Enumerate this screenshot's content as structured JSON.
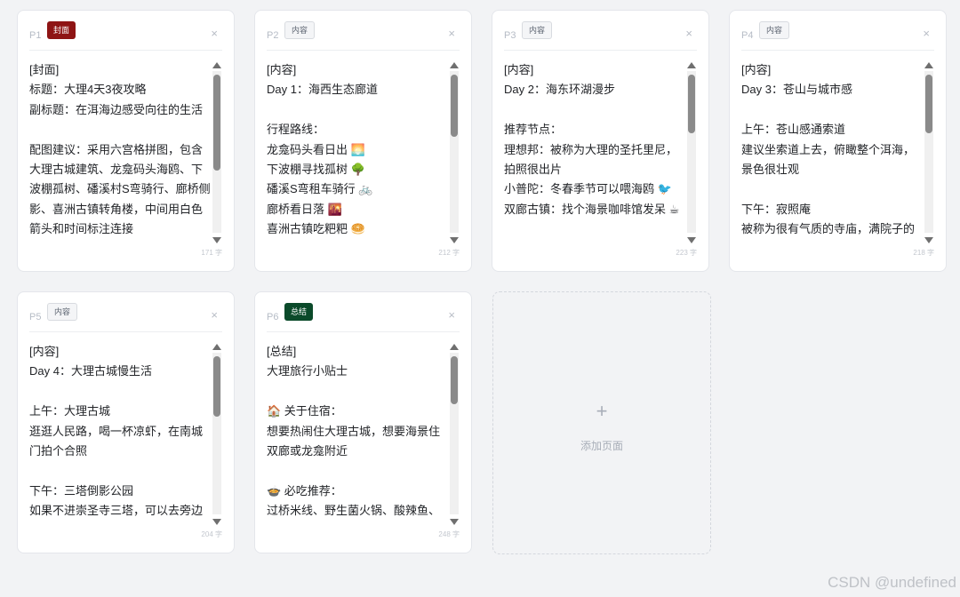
{
  "cards": [
    {
      "page": "P1",
      "tag": "封面",
      "text": "[封面]\n标题：大理4天3夜攻略\n副标题：在洱海边感受向往的生活\n\n配图建议：采用六宫格拼图，包含大理古城建筑、龙龛码头海鸥、下波棚孤树、磻溪村S弯骑行、廊桥侧影、喜洲古镇转角楼，中间用白色箭头和时间标注连接",
      "count": "171 字",
      "scroll_fraction": 0.0
    },
    {
      "page": "P2",
      "tag": "内容",
      "text": "[内容]\nDay 1：海西生态廊道\n\n行程路线：\n龙龛码头看日出 🌅\n下波棚寻找孤树 🌳\n磻溪S弯租车骑行 🚲\n廊桥看日落 🌇\n喜洲古镇吃粑粑 🥯",
      "count": "212 字",
      "scroll_fraction": 0.0
    },
    {
      "page": "P3",
      "tag": "内容",
      "text": "[内容]\nDay 2：海东环湖漫步\n\n推荐节点：\n理想邦：被称为大理的圣托里尼，拍照很出片\n小普陀：冬春季节可以喂海鸥 🐦\n双廊古镇：找个海景咖啡馆发呆 ☕",
      "count": "223 字",
      "scroll_fraction": 0.0
    },
    {
      "page": "P4",
      "tag": "内容",
      "text": "[内容]\nDay 3：苍山与城市感\n\n上午：苍山感通索道\n建议坐索道上去，俯瞰整个洱海，景色很壮观\n\n下午：寂照庵\n被称为很有气质的寺庙，满院子的",
      "count": "218 字",
      "scroll_fraction": 0.0
    },
    {
      "page": "P5",
      "tag": "内容",
      "text": "[内容]\nDay 4：大理古城慢生活\n\n上午：大理古城\n逛逛人民路，喝一杯凉虾，在南城门拍个合照\n\n下午：三塔倒影公园\n如果不进崇圣寺三塔，可以去旁边",
      "count": "204 字",
      "scroll_fraction": 0.0
    },
    {
      "page": "P6",
      "tag": "总结",
      "text": "[总结]\n大理旅行小贴士\n\n🏠 关于住宿：\n想要热闹住大理古城，想要海景住双廊或龙龛附近\n\n🍲 必吃推荐：\n过桥米线、野生菌火锅、酸辣鱼、",
      "count": "248 字",
      "scroll_fraction": 0.0
    }
  ],
  "close_symbol": "×",
  "add_page": {
    "plus": "+",
    "label": "添加页面"
  },
  "watermark": "CSDN @undefined",
  "colors": {
    "cover_tag": "#8e1414",
    "summary_tag": "#0b4a2a",
    "content_tag_bg": "#f4f5f7",
    "page_bg": "#f2f3f5"
  },
  "icons": [
    "close-icon",
    "plus-icon",
    "scroll-up-arrow",
    "scroll-down-arrow"
  ]
}
